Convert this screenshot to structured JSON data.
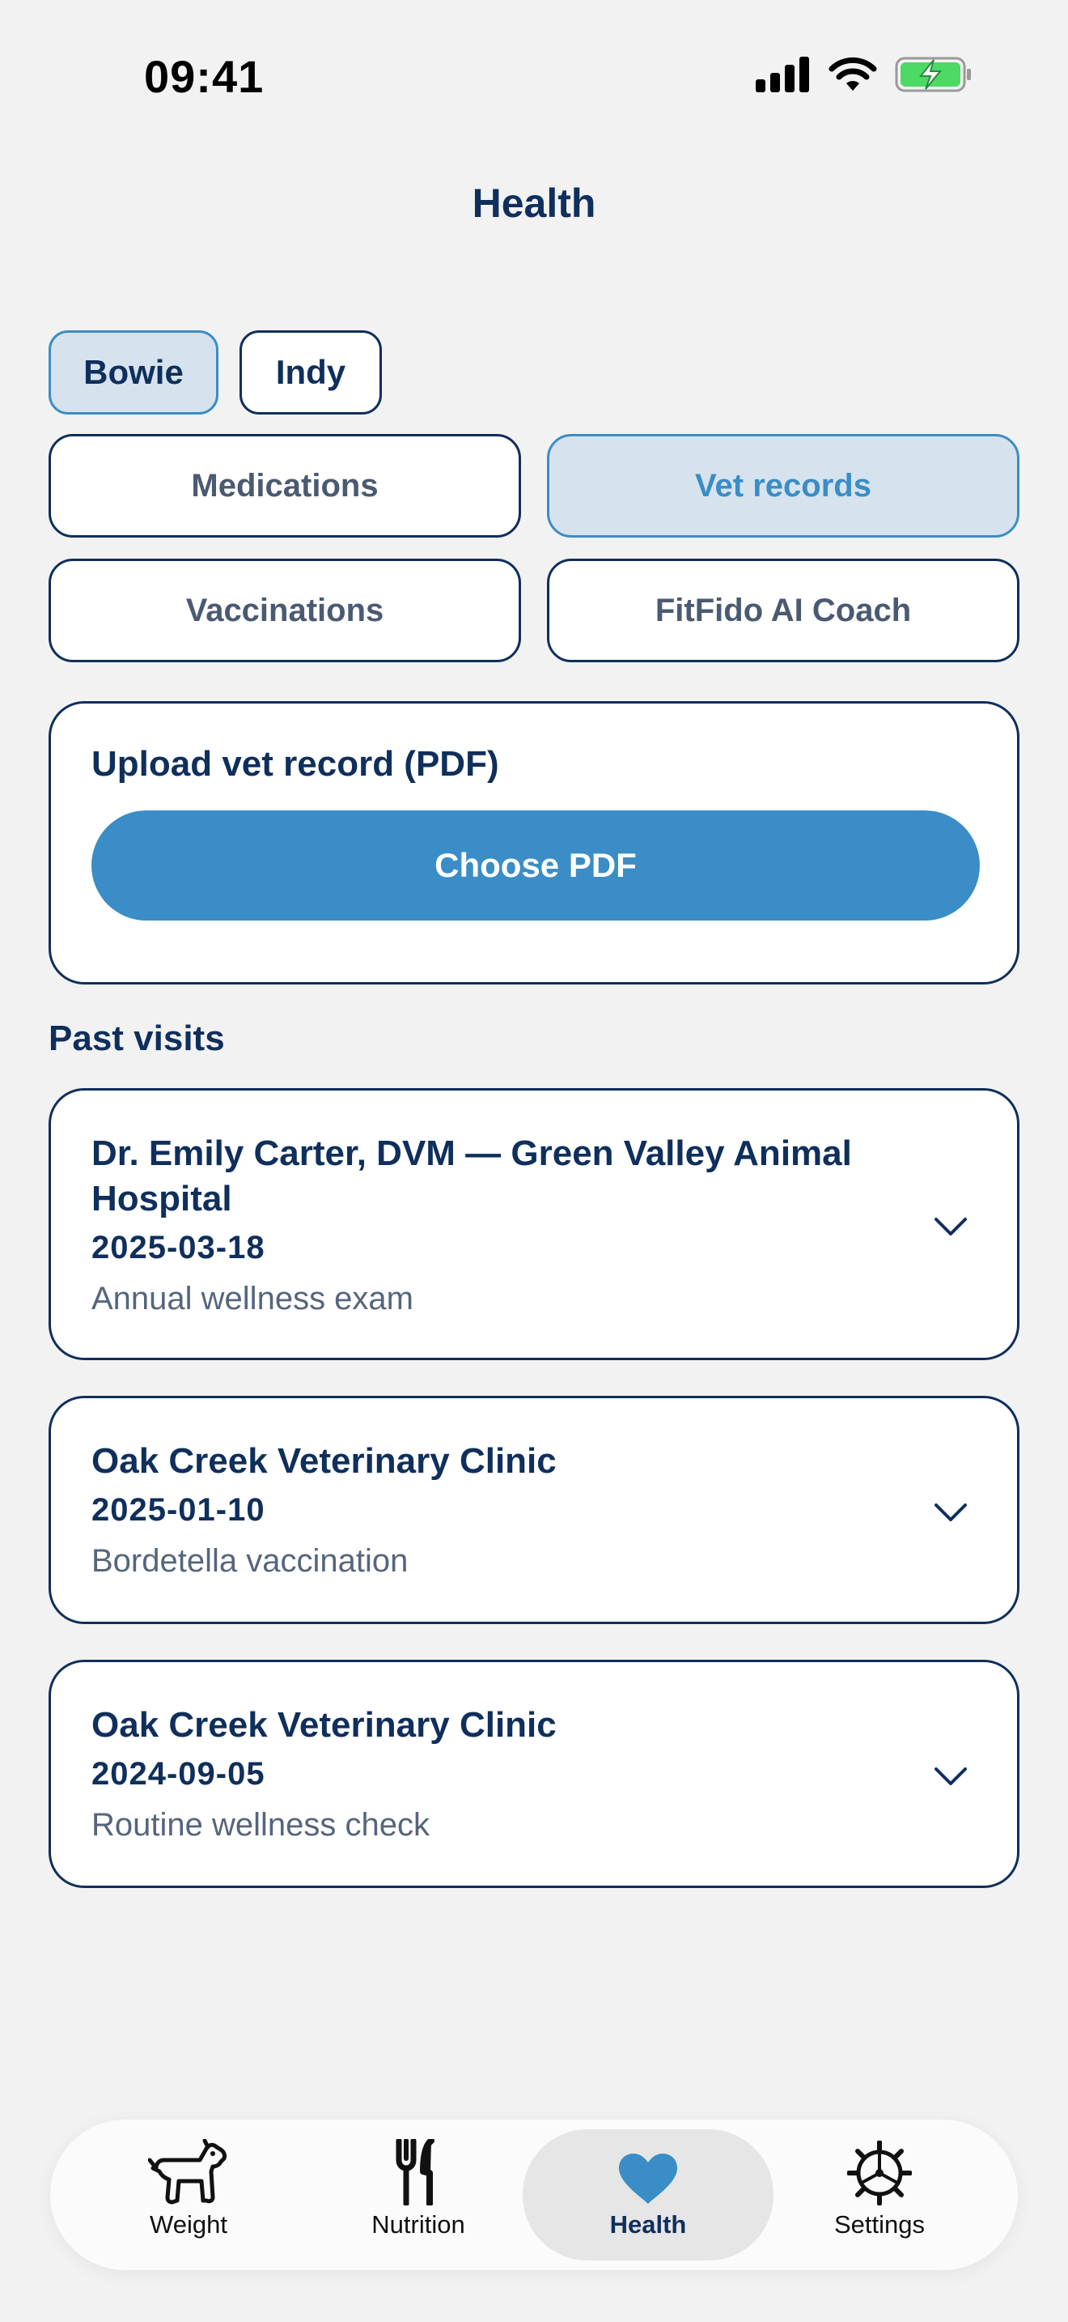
{
  "status_bar": {
    "time": "09:41"
  },
  "header": {
    "title": "Health"
  },
  "pets": [
    {
      "name": "Bowie",
      "active": true
    },
    {
      "name": "Indy",
      "active": false
    }
  ],
  "segments": [
    {
      "label": "Medications",
      "active": false
    },
    {
      "label": "Vet records",
      "active": true
    },
    {
      "label": "Vaccinations",
      "active": false
    },
    {
      "label": "FitFido AI Coach",
      "active": false
    }
  ],
  "upload": {
    "title": "Upload vet record (PDF)",
    "button_label": "Choose PDF"
  },
  "past_visits": {
    "title": "Past visits",
    "items": [
      {
        "name": "Dr. Emily Carter, DVM — Green Valley Animal Hospital",
        "date": "2025-03-18",
        "description": "Annual wellness exam"
      },
      {
        "name": "Oak Creek Veterinary Clinic",
        "date": "2025-01-10",
        "description": "Bordetella vaccination"
      },
      {
        "name": "Oak Creek Veterinary Clinic",
        "date": "2024-09-05",
        "description": "Routine wellness check"
      }
    ]
  },
  "tabbar": {
    "items": [
      {
        "label": "Weight",
        "icon": "dog-icon",
        "active": false
      },
      {
        "label": "Nutrition",
        "icon": "fork-knife-icon",
        "active": false
      },
      {
        "label": "Health",
        "icon": "heart-icon",
        "active": true
      },
      {
        "label": "Settings",
        "icon": "gear-icon",
        "active": false
      }
    ]
  },
  "colors": {
    "primary": "#3a8dc6",
    "navy": "#0f2f5c",
    "active_tint": "#d6e3ee",
    "background": "#f2f2f2",
    "battery_green": "#4cd964"
  }
}
